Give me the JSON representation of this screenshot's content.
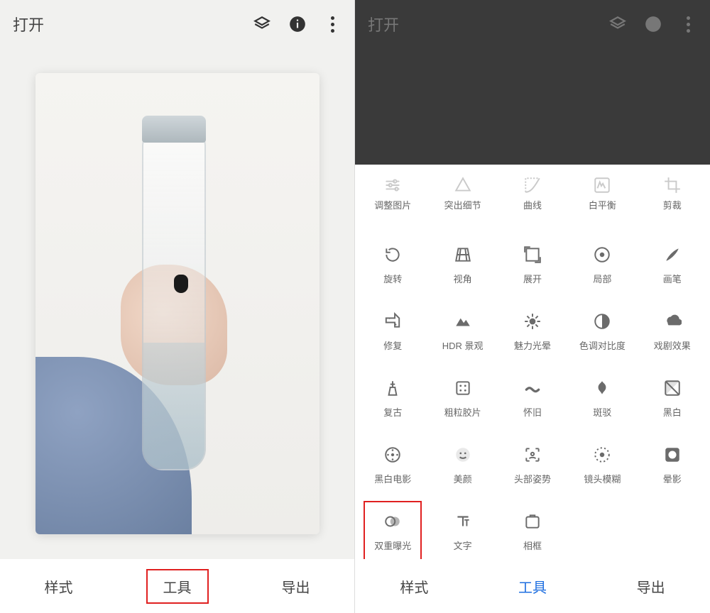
{
  "left": {
    "open_label": "打开",
    "nav": {
      "styles": "样式",
      "tools": "工具",
      "export": "导出"
    }
  },
  "right": {
    "open_label": "打开",
    "nav": {
      "styles": "样式",
      "tools": "工具",
      "export": "导出"
    },
    "tools": [
      {
        "id": "tune",
        "label": "调整图片"
      },
      {
        "id": "details",
        "label": "突出细节"
      },
      {
        "id": "curves",
        "label": "曲线"
      },
      {
        "id": "wb",
        "label": "白平衡"
      },
      {
        "id": "crop",
        "label": "剪裁"
      },
      {
        "id": "rotate",
        "label": "旋转"
      },
      {
        "id": "perspective",
        "label": "视角"
      },
      {
        "id": "expand",
        "label": "展开"
      },
      {
        "id": "selective",
        "label": "局部"
      },
      {
        "id": "brush",
        "label": "画笔"
      },
      {
        "id": "healing",
        "label": "修复"
      },
      {
        "id": "hdr",
        "label": "HDR 景观"
      },
      {
        "id": "glamour",
        "label": "魅力光晕"
      },
      {
        "id": "tonal",
        "label": "色调对比度"
      },
      {
        "id": "drama",
        "label": "戏剧效果"
      },
      {
        "id": "vintage",
        "label": "复古"
      },
      {
        "id": "grainy",
        "label": "粗粒胶片"
      },
      {
        "id": "retrolux",
        "label": "怀旧"
      },
      {
        "id": "grunge",
        "label": "斑驳"
      },
      {
        "id": "bw",
        "label": "黑白"
      },
      {
        "id": "noir",
        "label": "黑白电影"
      },
      {
        "id": "portrait",
        "label": "美颜"
      },
      {
        "id": "headpose",
        "label": "头部姿势"
      },
      {
        "id": "lensblur",
        "label": "镜头模糊"
      },
      {
        "id": "vignette",
        "label": "晕影"
      },
      {
        "id": "double",
        "label": "双重曝光",
        "highlight": true
      },
      {
        "id": "text",
        "label": "文字"
      },
      {
        "id": "frames",
        "label": "相框"
      }
    ]
  }
}
